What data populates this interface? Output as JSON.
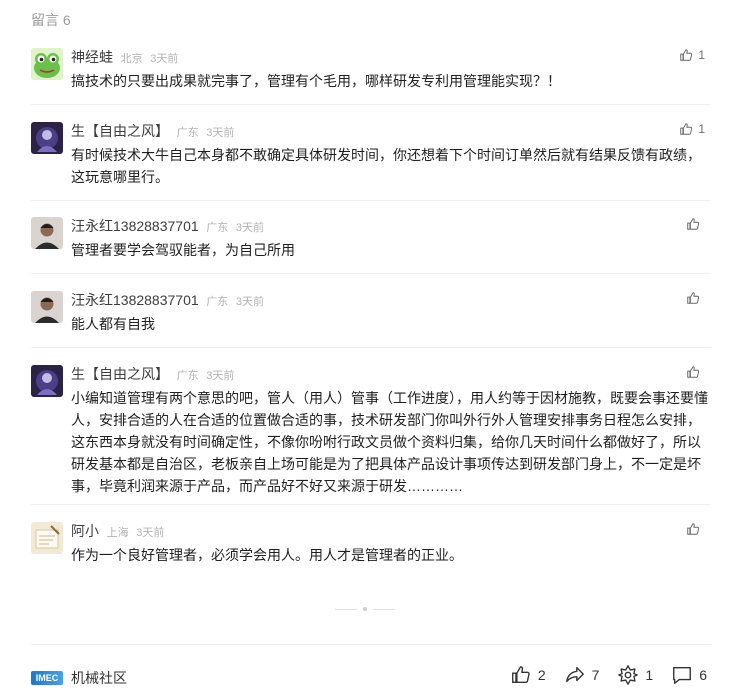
{
  "header": {
    "title": "留言 6"
  },
  "comments": [
    {
      "name": "神经蛙",
      "location": "北京",
      "time": "3天前",
      "likes": "1",
      "text": "搞技术的只要出成果就完事了，管理有个毛用，哪样研发专利用管理能实现？！"
    },
    {
      "name": "生【自由之风】",
      "location": "广东",
      "time": "3天前",
      "likes": "1",
      "text": "有时候技术大牛自己本身都不敢确定具体研发时间，你还想着下个时间订单然后就有结果反馈有政绩，这玩意哪里行。"
    },
    {
      "name": "汪永红13828837701",
      "location": "广东",
      "time": "3天前",
      "likes": "",
      "text": "管理者要学会驾驭能者，为自己所用"
    },
    {
      "name": "汪永红13828837701",
      "location": "广东",
      "time": "3天前",
      "likes": "",
      "text": "能人都有自我"
    },
    {
      "name": "生【自由之风】",
      "location": "广东",
      "time": "3天前",
      "likes": "",
      "text": "小编知道管理有两个意思的吧，管人（用人）管事（工作进度），用人约等于因材施教，既要会事还要懂人，安排合适的人在合适的位置做合适的事，技术研发部门你叫外行外人管理安排事务日程怎么安排，这东西本身就没有时间确定性，不像你吩咐行政文员做个资料归集，给你几天时间什么都做好了，所以研发基本都是自治区，老板亲自上场可能是为了把具体产品设计事项传达到研发部门身上，不一定是坏事，毕竟利润来源于产品，而产品好不好又来源于研发…………"
    },
    {
      "name": "阿小",
      "location": "上海",
      "time": "3天前",
      "likes": "",
      "text": "作为一个良好管理者，必须学会用人。用人才是管理者的正业。"
    }
  ],
  "footer": {
    "brand_logo": "IMEC",
    "brand_name": "机械社区",
    "like_count": "2",
    "share_count": "7",
    "recommend_count": "1",
    "comment_count": "6"
  },
  "colors": {
    "muted": "#b3b3b3",
    "text": "#1f1f1f",
    "accent": "#1e78c8"
  }
}
